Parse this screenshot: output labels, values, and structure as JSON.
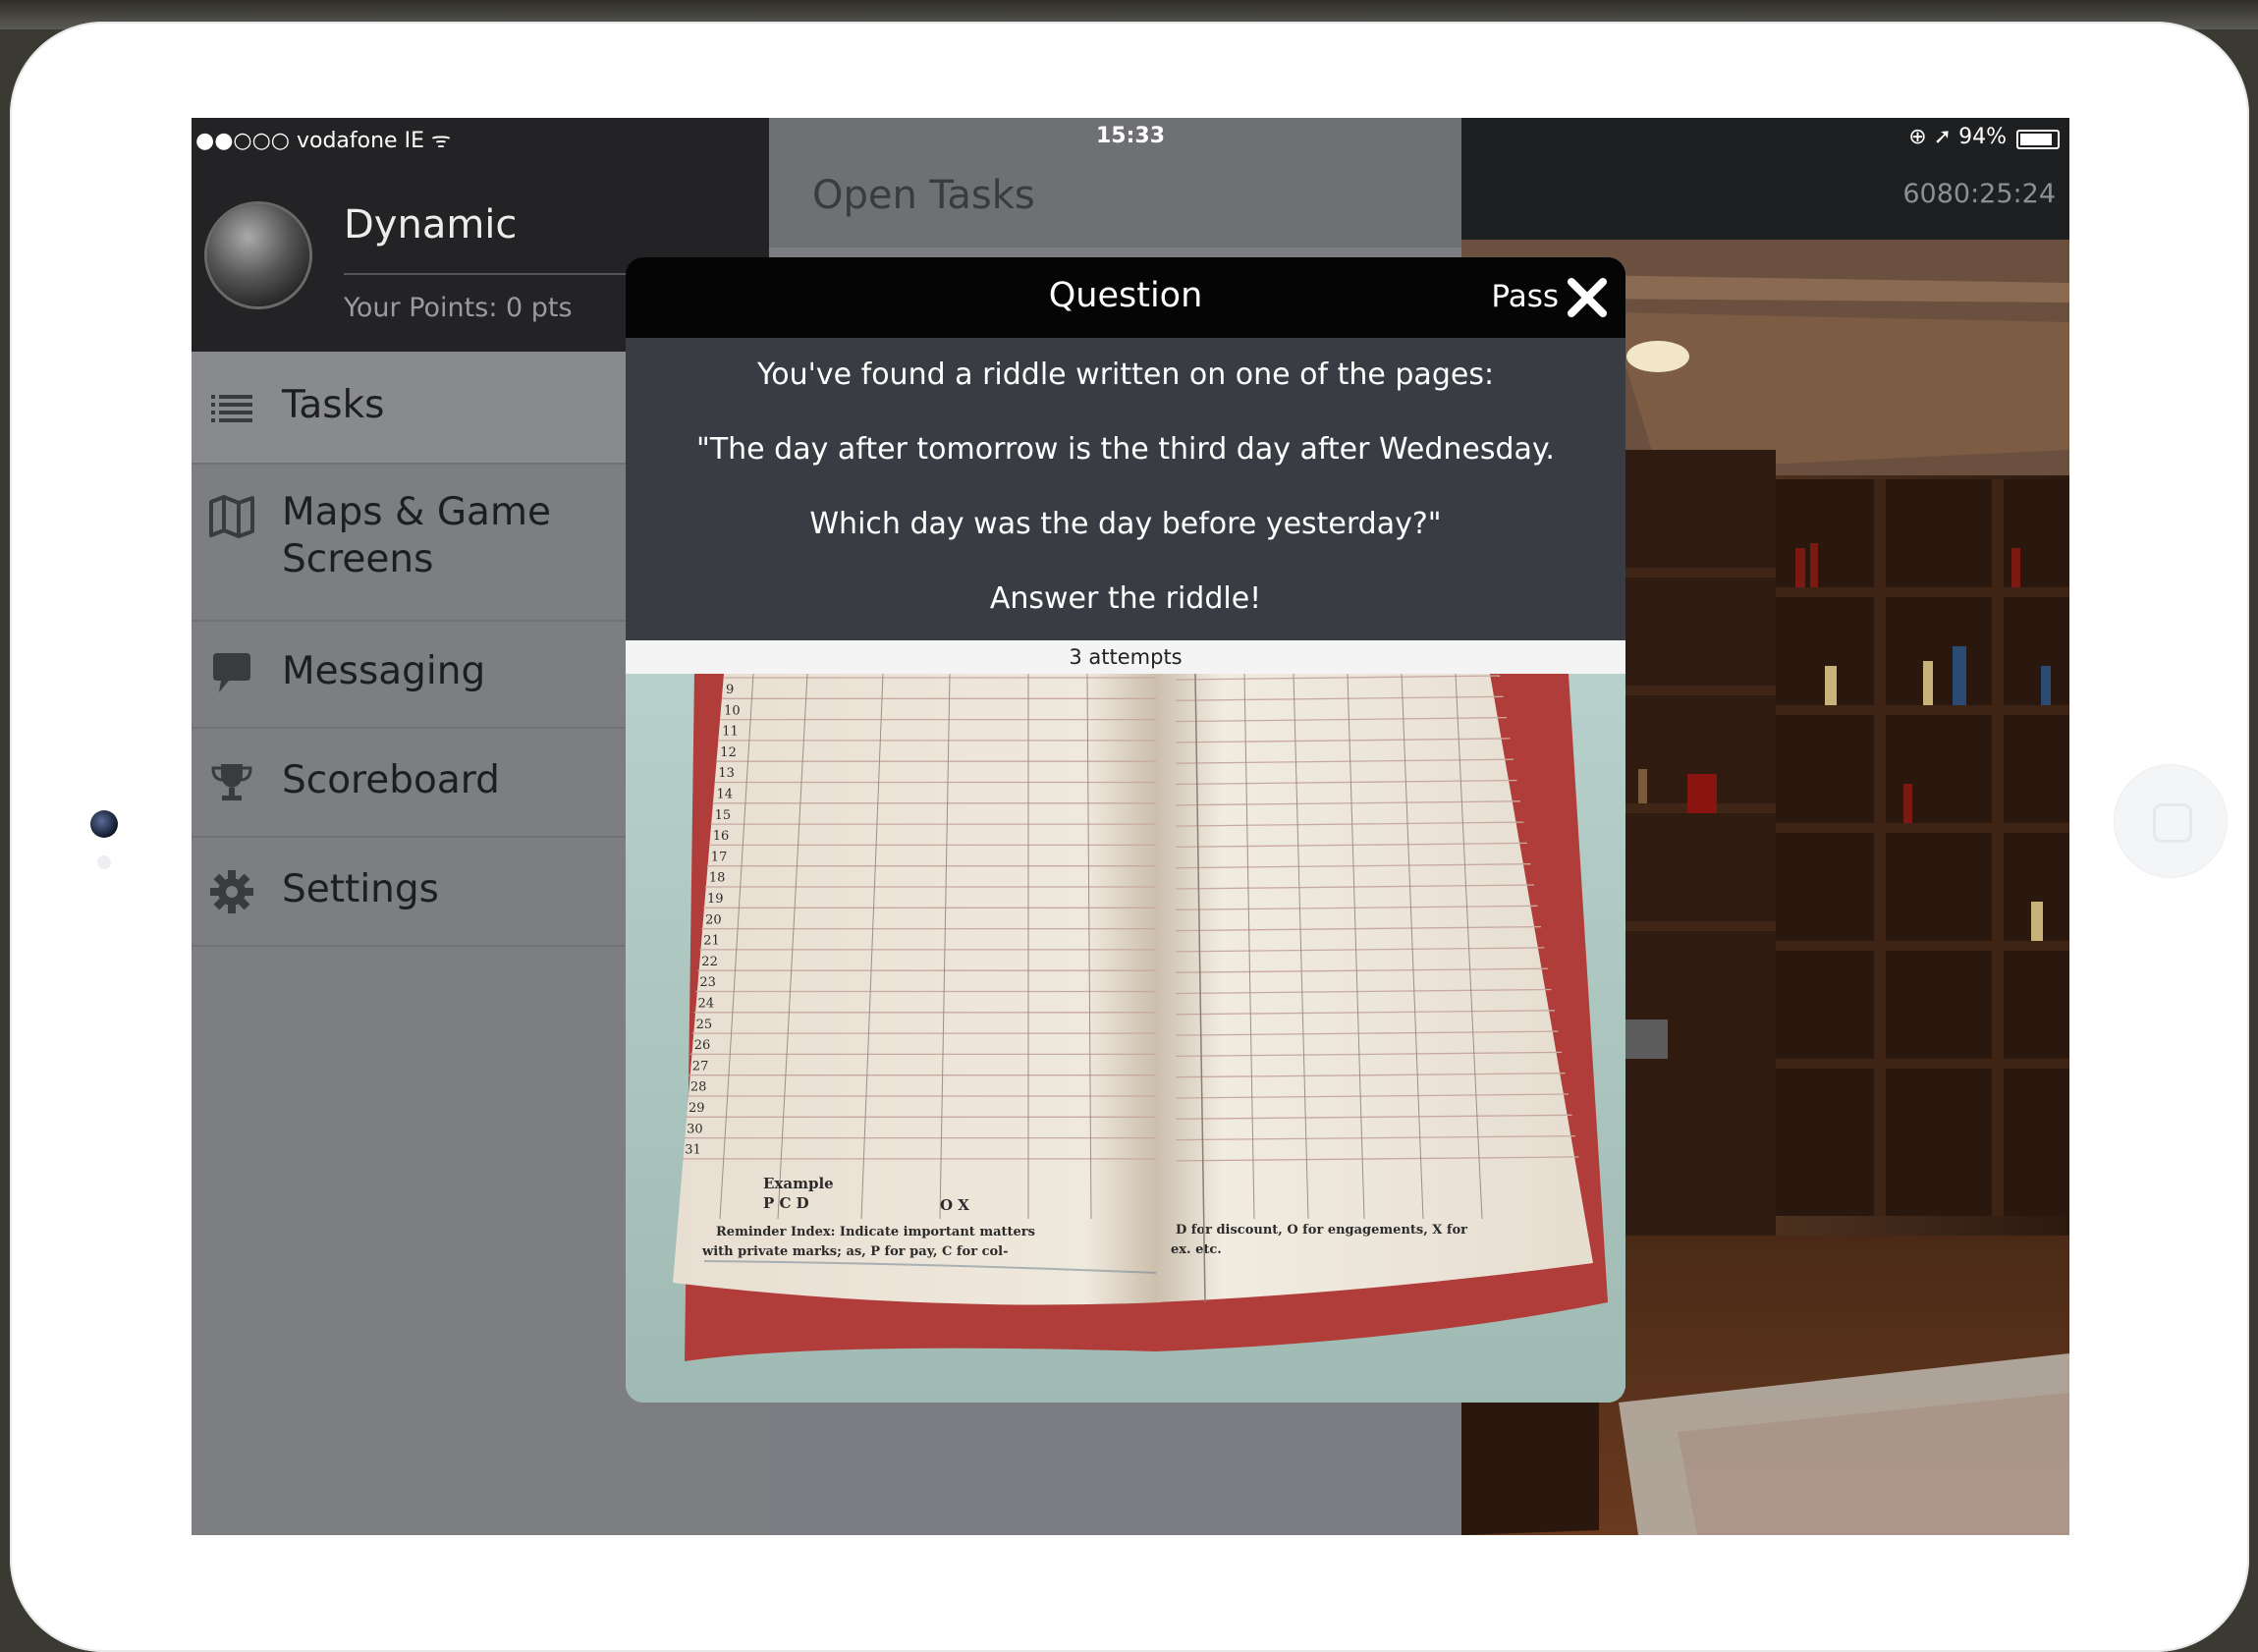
{
  "status_bar": {
    "carrier": "●●○○○ vodafone IE ᯤ",
    "time": "15:33",
    "battery": "⊕ ➚ 94%"
  },
  "sidebar": {
    "user_name": "Dynamic",
    "points": "Your Points: 0 pts",
    "items": [
      {
        "label": "Tasks",
        "icon": "list-icon"
      },
      {
        "label_line1": "Maps & Game",
        "label_line2": "Screens",
        "icon": "map-icon"
      },
      {
        "label": "Messaging",
        "icon": "speech-bubble-icon"
      },
      {
        "label": "Scoreboard",
        "icon": "trophy-icon"
      },
      {
        "label": "Settings",
        "icon": "gear-icon"
      }
    ]
  },
  "main": {
    "title": "Open Tasks"
  },
  "right_panel": {
    "timer": "6080:25:24"
  },
  "modal": {
    "title": "Question",
    "pass_label": "Pass",
    "lines": [
      "You've found a riddle written on one of the pages:",
      "\"The day after tomorrow is the third day after Wednesday.",
      "Which day was the day before yesterday?\"",
      "Answer the riddle!"
    ],
    "attempts": "3 attempts"
  },
  "ledger": {
    "row_numbers": [
      "9",
      "10",
      "11",
      "12",
      "13",
      "14",
      "15",
      "16",
      "17",
      "18",
      "19",
      "20",
      "21",
      "22",
      "23",
      "24",
      "25",
      "26",
      "27",
      "28",
      "29",
      "30",
      "31"
    ],
    "example_label": "Example",
    "pcd": "P C D",
    "ox": "O X",
    "footer_left_1": "Reminder Index: Indicate important matters",
    "footer_left_2": "with private marks; as, P for pay, C for col-",
    "footer_right": "D for discount, O for engagements, X for",
    "footer_right_2": "ex. etc."
  },
  "colors": {
    "overlay_grey": "#7c7e82",
    "header_dark": "#232325",
    "modal_body": "#3a3c43",
    "modal_header": "#050505"
  }
}
